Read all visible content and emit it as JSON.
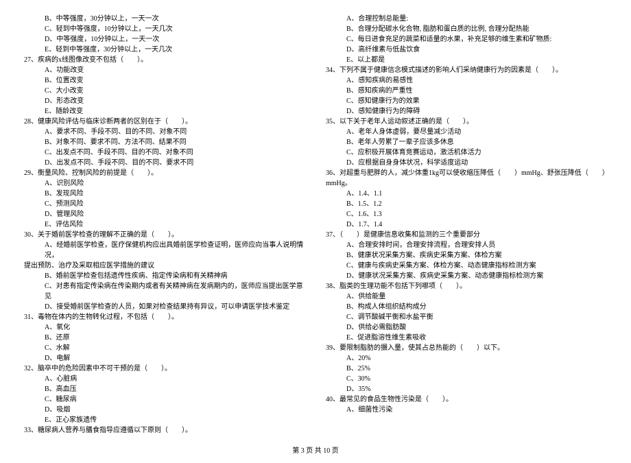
{
  "leftCol": {
    "opts26": {
      "b": "B、中等强度，30分钟以上，一天一次",
      "c": "C、轻到中等强度，10分钟以上，一天几次",
      "d": "D、中等强度，10分钟以上，一天一次",
      "e": "E、轻到中等强度，30分钟以上，一天几次"
    },
    "q27": "27、疾病的x线图像改变不包括（　　）。",
    "opts27": {
      "a": "A、功能改变",
      "b": "B、位置改变",
      "c": "C、大小改变",
      "d": "D、形态改变",
      "e": "E、随龄改变"
    },
    "q28": "28、健康风险评估与临床诊断两者的区别在于（　　）。",
    "opts28": {
      "a": "A、要求不同、手段不同、目的不同、对象不同",
      "b": "B、对象不同、要求不同、方法不同、结果不同",
      "c": "C、出发点不同、手段不同、目的不同、对象不同",
      "d": "D、出发点不同、手段不同、目的不同、要求不同"
    },
    "q29": "29、衡量风险、控制风险的前提是（　　）。",
    "opts29": {
      "a": "A、识别风险",
      "b": "B、发现风险",
      "c": "C、预测风险",
      "d": "D、管理风险",
      "e": "E、评估风险"
    },
    "q30": "30、关于婚前医学检查的理解不正确的是（　　）。",
    "opts30": {
      "a": "A、经婚前医学检查，医疗保健机构应出具婚前医学检查证明，医师应向当事人说明情况，",
      "aCont": "提出预防、治疗及采取相应医学措施的建议",
      "b": "B、婚前医学检查包括遗传性疾病、指定传染病和有关精神病",
      "c": "C、对患有指定传染病在传染期内或者有关精神病在发病期内的，医师应当提出医学意见",
      "d": "D、接受婚前医学检查的人员，如果对检查结果持有异议，可以申请医学技术鉴定"
    },
    "q31": "31、毒物在体内的生物转化过程，不包括（　　）。",
    "opts31": {
      "a": "A、氧化",
      "b": "B、还原",
      "c": "C、水解",
      "d": "D、电解"
    },
    "q32": "32、脑卒中的危险因素中不可干预的是（　　）。",
    "opts32": {
      "a": "A、心脏病",
      "b": "B、高血压",
      "c": "C、糖尿病",
      "d": "D、吸烟",
      "e": "E、正心家族遗传"
    },
    "q33": "33、糖尿病人营养与膳食指导应遵循以下原则（　　）。"
  },
  "rightCol": {
    "opts33": {
      "a": "A、合理控制总能量:",
      "b": "B、合理分配碳水化合物, 脂肪和蛋白质的比例, 合理分配热能",
      "c": "C、每日进食充足的蔬菜和适量的水果，补充足够的维生素和矿物质:",
      "d": "D、高纤维素与低盐饮食",
      "e": "E、以上都是"
    },
    "q34": "34、下列不属于健康信念模式描述的影响人们采纳健康行为的因素是（　　）。",
    "opts34": {
      "a": "A、感知疾病的易感性",
      "b": "B、感知疾病的严重性",
      "c": "C、感知健康行为的效果",
      "d": "D、感知健康行为的障碍"
    },
    "q35": "35、以下关于老年人运动叙述正确的是（　　）。",
    "opts35": {
      "a": "A、老年人身体虚弱，要尽量减少活动",
      "b": "B、老年人劳累了一辈子应该多休息",
      "c": "C、应积极开展体育竞赛运动，激活机体活力",
      "d": "D、应根据自身身体状况，科学适度运动"
    },
    "q36": "36、对超重与肥胖的人，减少体重1kg可以使收缩压降低（　　）mmHg、舒张压降低（　　）mmHg。",
    "opts36": {
      "a": "A、1.4、1.1",
      "b": "B、1.5、1.2",
      "c": "C、1.6、1.3",
      "d": "D、1.7、1.4"
    },
    "q37": "37、（　　）是健康信息收集和监测的三个重要部分",
    "opts37": {
      "a": "A、合理安排时间，合理安排流程，合理安排人员",
      "b": "B、健康状况采集方案、疾病史采集方案、体检方案",
      "c": "C、健康与疾病史采集方案、体检方案、动态健康指标检测方案",
      "d": "D、健康状况采集方案、疾病史采集方案、动态健康指标检测方案"
    },
    "q38": "38、脂类的生理功能不包括下列哪项（　　）。",
    "opts38": {
      "a": "A、供给能量",
      "b": "B、构成人体组织结构成分",
      "c": "C、调节酸碱平衡和水盐平衡",
      "d": "D、供给必需脂肪酸",
      "e": "E、促进脂溶性维生素吸收"
    },
    "q39": "39、要限制脂肪的摄入量，使其占总热能的（　　）以下。",
    "opts39": {
      "a": "A、20%",
      "b": "B、25%",
      "c": "C、30%",
      "d": "D、35%"
    },
    "q40": "40、最常见的食品生物性污染是（　　）。",
    "opts40": {
      "a": "A、细菌性污染"
    }
  },
  "footer": "第 3 页 共 10 页"
}
